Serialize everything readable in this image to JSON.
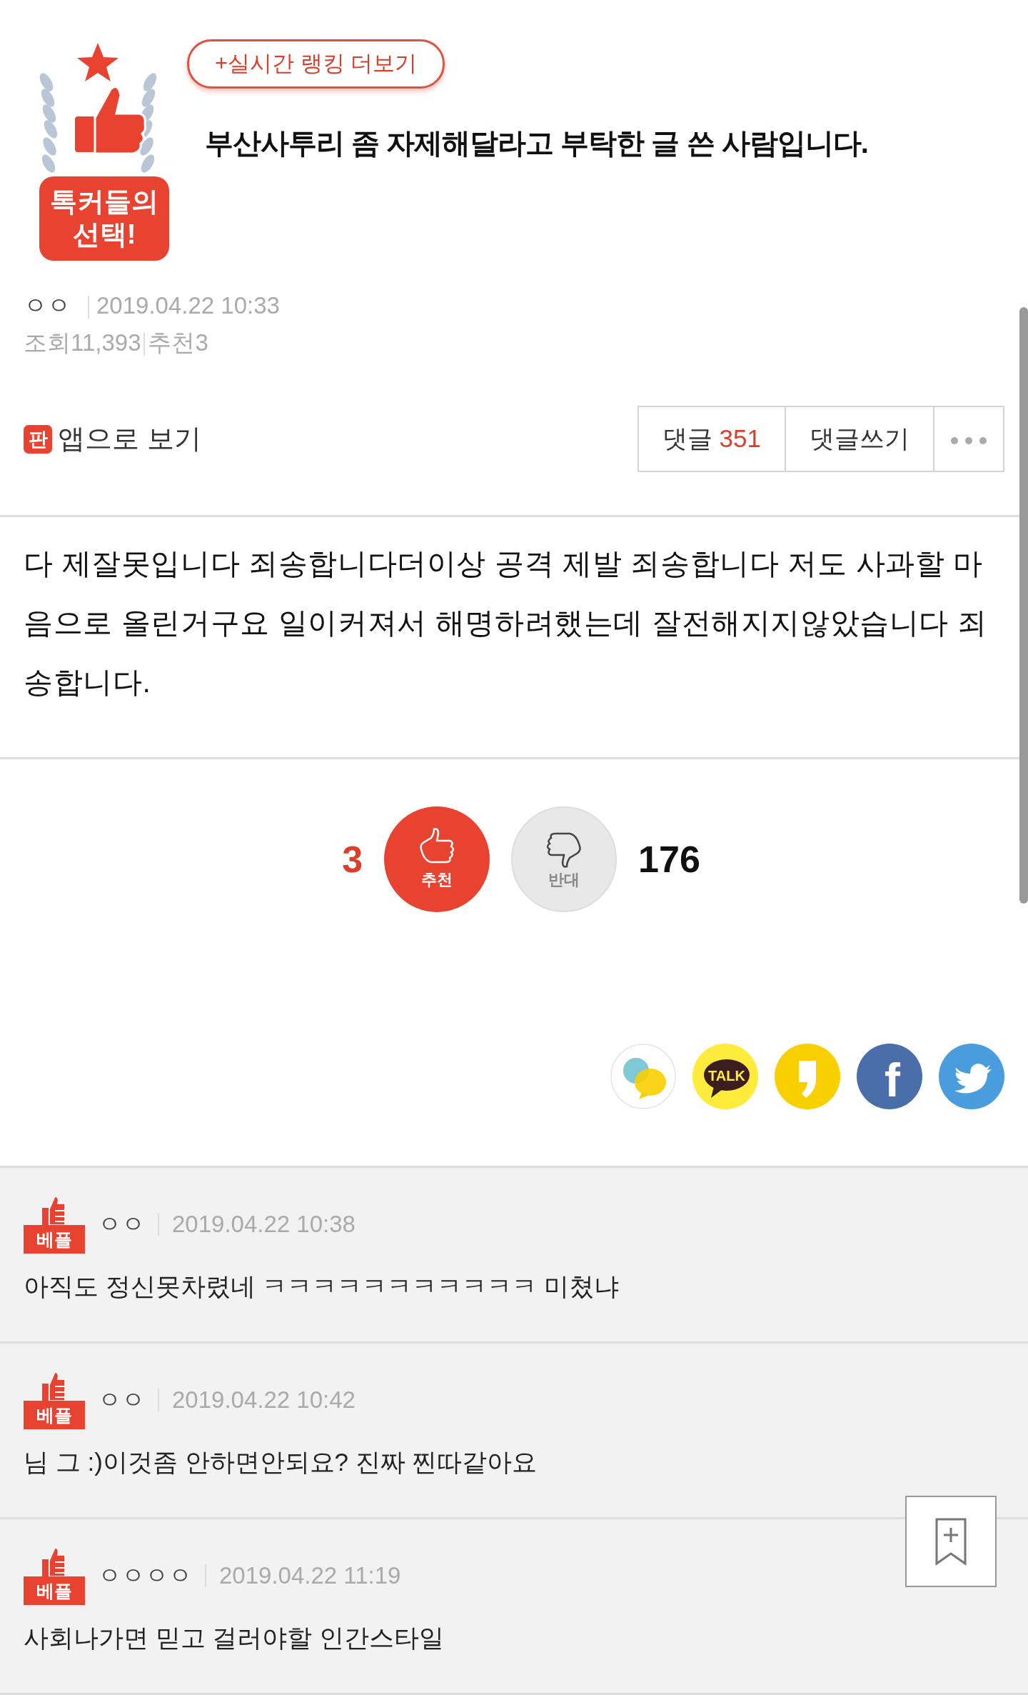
{
  "ranking_link": "+실시간 랭킹 더보기",
  "emblem_lines": [
    "톡커들의",
    "선택!"
  ],
  "post": {
    "title": "부산사투리 좀 자제해달라고 부탁한 글 쓴 사람입니다.",
    "author": "ㅇㅇ",
    "date": "2019.04.22 10:33",
    "views_label": "조회",
    "views": "11,393",
    "recommend_label": "추천",
    "recommend": "3"
  },
  "app_link": {
    "icon_text": "판",
    "label": "앱으로 보기"
  },
  "actions": [
    {
      "kind": "comments",
      "label": "댓글",
      "count": "351"
    },
    {
      "kind": "write",
      "label": "댓글쓰기"
    },
    {
      "kind": "more"
    }
  ],
  "body": "다 제잘못입니다 죄송합니다더이상 공격 제발 죄송합니다 저도 사과할 마음으로 올린거구요 일이커져서 해명하려했는데 잘전해지지않았습니다 죄송합니다.",
  "votes": {
    "up_count": "3",
    "up_label": "추천",
    "down_label": "반대",
    "down_count": "176"
  },
  "share": [
    {
      "kind": "chat"
    },
    {
      "kind": "talk",
      "text": "TALK"
    },
    {
      "kind": "story"
    },
    {
      "kind": "facebook",
      "text": "f"
    },
    {
      "kind": "twitter"
    }
  ],
  "comments": [
    {
      "badge": "베플",
      "author": "ㅇㅇ",
      "date": "2019.04.22 10:38",
      "text": "아직도 정신못차렸네 ㅋㅋㅋㅋㅋㅋㅋㅋㅋㅋㅋ 미쳤냐"
    },
    {
      "badge": "베플",
      "author": "ㅇㅇ",
      "date": "2019.04.22 10:42",
      "text": "님 그 :)이것좀 안하면안되요? 진짜 찐따같아요"
    },
    {
      "badge": "베플",
      "author": "ㅇㅇㅇㅇ",
      "date": "2019.04.22 11:19",
      "text": "사회나가면 믿고 걸러야할 인간스타일"
    }
  ]
}
